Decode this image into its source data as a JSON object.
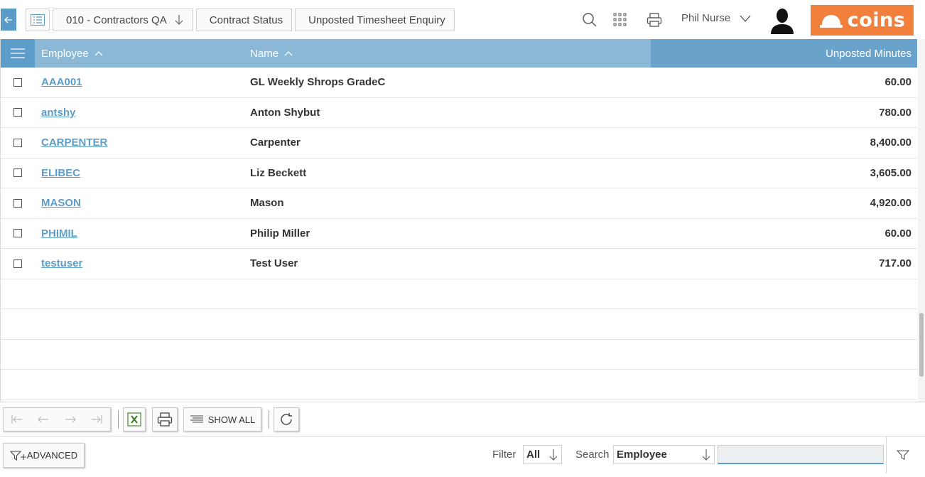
{
  "breadcrumbs": [
    {
      "label": "010 - Contractors QA",
      "has_dropdown": true
    },
    {
      "label": "Contract Status",
      "has_dropdown": false
    },
    {
      "label": "Unposted Timesheet Enquiry",
      "has_dropdown": false
    }
  ],
  "user": {
    "name": "Phil Nurse"
  },
  "logo": {
    "text": "coins",
    "color": "#f0803c"
  },
  "table": {
    "columns": [
      {
        "label": "Employee",
        "sorted": "asc"
      },
      {
        "label": "Name",
        "sorted": "asc"
      },
      {
        "label": "Unposted Minutes",
        "sorted": null
      }
    ],
    "rows": [
      {
        "employee": "AAA001",
        "name": "GL Weekly Shrops GradeC",
        "minutes": "60.00"
      },
      {
        "employee": "antshy",
        "name": "Anton Shybut",
        "minutes": "780.00"
      },
      {
        "employee": "CARPENTER",
        "name": "Carpenter",
        "minutes": "8,400.00"
      },
      {
        "employee": "ELIBEC",
        "name": "Liz Beckett",
        "minutes": "3,605.00"
      },
      {
        "employee": "MASON",
        "name": "Mason",
        "minutes": "4,920.00"
      },
      {
        "employee": "PHIMIL",
        "name": "Philip Miller",
        "minutes": "60.00"
      },
      {
        "employee": "testuser",
        "name": "Test User",
        "minutes": "717.00"
      }
    ]
  },
  "toolbar": {
    "show_all_label": "SHOW ALL"
  },
  "filterbar": {
    "advanced_label": "ADVANCED",
    "filter_label": "Filter",
    "filter_value": "All",
    "search_label": "Search",
    "search_field": "Employee",
    "search_value": ""
  },
  "colors": {
    "accent": "#5d9dc9",
    "header": "#8ab8d6",
    "header_dark": "#69a3cc"
  }
}
